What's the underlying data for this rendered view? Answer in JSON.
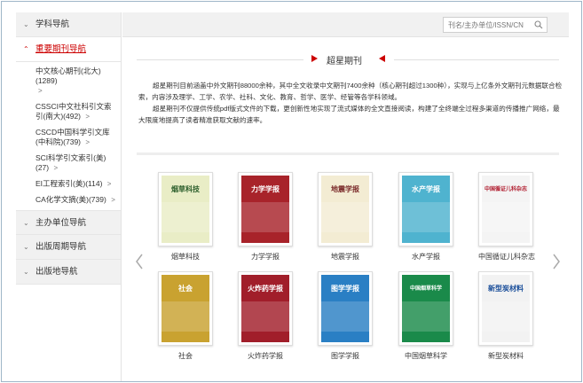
{
  "sidebar": {
    "sections": [
      {
        "label": "学科导航"
      },
      {
        "label": "重要期刊导航"
      },
      {
        "label": "主办单位导航"
      },
      {
        "label": "出版周期导航"
      },
      {
        "label": "出版地导航"
      }
    ],
    "sub_items": [
      {
        "label": "中文核心期刊(北大)(1289)"
      },
      {
        "label": "CSSCI中文社科引文索引(南大)(492)"
      },
      {
        "label": "CSCD中国科学引文库(中科院)(739)"
      },
      {
        "label": "SCI科学引文索引(美)(27)"
      },
      {
        "label": "EI工程索引(美)(114)"
      },
      {
        "label": "CA化学文摘(美)(739)"
      }
    ]
  },
  "search": {
    "placeholder": "刊名/主办单位/ISSN/CN"
  },
  "content": {
    "title": "超星期刊",
    "paragraph1": "超星期刊目前涵盖中外文期刊88000余种，其中全文收录中文期刊7400余种（核心期刊超过1300种），实现与上亿条外文期刊元数据联合检索，内容涉及理学、工学、农学、社科、文化、教育、哲学、医学、经管等各学科领域。",
    "paragraph2": "超星期刊不仅提供传统pdf版式文件的下载，更创新性地实现了流式媒体的全文直接阅读，构建了全终端全过程多渠道的传播推广网络，最大限度地提高了读者精准获取文献的速率。"
  },
  "journals": [
    {
      "name": "烟草科技",
      "cover_text": "烟草科技",
      "cover_bg": "#e9edc6",
      "cover_fg": "#2b5e2b"
    },
    {
      "name": "力学学报",
      "cover_text": "力学学报",
      "cover_bg": "#a8232a",
      "cover_fg": "#ffffff"
    },
    {
      "name": "地震学报",
      "cover_text": "地震学报",
      "cover_bg": "#f3ecd3",
      "cover_fg": "#7a2a2a"
    },
    {
      "name": "水产学报",
      "cover_text": "水产学报",
      "cover_bg": "#4fb3cf",
      "cover_fg": "#ffffff"
    },
    {
      "name": "中国循证儿科杂志",
      "cover_text": "中国循证儿科杂志",
      "cover_bg": "#f4f4f4",
      "cover_fg": "#b01c2e"
    },
    {
      "name": "社会",
      "cover_text": "社会",
      "cover_bg": "#c9a230",
      "cover_fg": "#ffffff"
    },
    {
      "name": "火炸药学报",
      "cover_text": "火炸药学报",
      "cover_bg": "#a11e2a",
      "cover_fg": "#ffffff"
    },
    {
      "name": "图学学报",
      "cover_text": "图学学报",
      "cover_bg": "#2a7fc4",
      "cover_fg": "#ffffff"
    },
    {
      "name": "中国烟草科学",
      "cover_text": "中国烟草科学",
      "cover_bg": "#1a8a4a",
      "cover_fg": "#ffffff"
    },
    {
      "name": "新型炭材料",
      "cover_text": "新型炭材料",
      "cover_bg": "#f2f2f2",
      "cover_fg": "#1a4e9a"
    }
  ],
  "accent_color": "#cc0000"
}
